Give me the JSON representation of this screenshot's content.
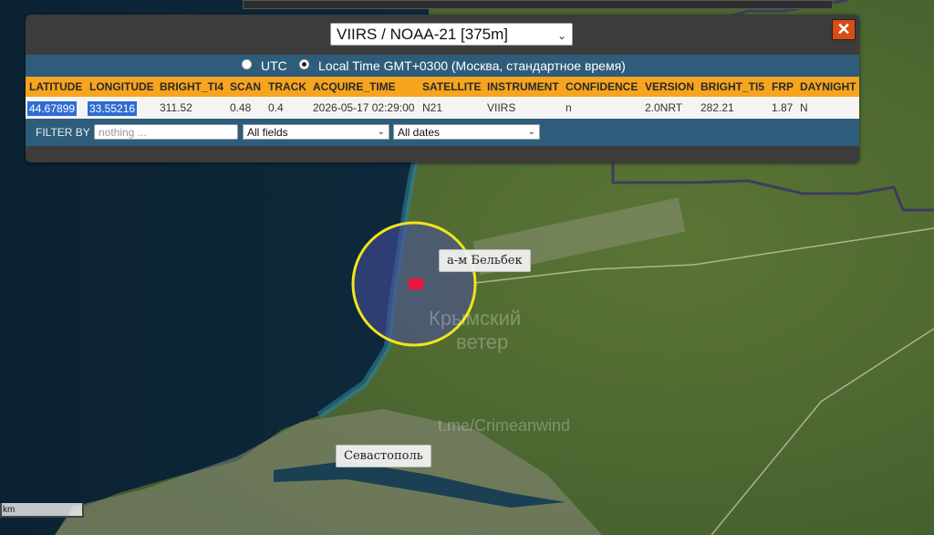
{
  "panel": {
    "satellite_select": "VIIRS / NOAA-21 [375m]",
    "close_label": "✕",
    "time_mode": {
      "utc_label": "UTC",
      "local_label": "Local Time GMT+0300 (Москва, стандартное время)",
      "selected": "local"
    },
    "columns": [
      "LATITUDE",
      "LONGITUDE",
      "BRIGHT_TI4",
      "SCAN",
      "TRACK",
      "ACQUIRE_TIME",
      "SATELLITE",
      "INSTRUMENT",
      "CONFIDENCE",
      "VERSION",
      "BRIGHT_TI5",
      "FRP",
      "DAYNIGHT"
    ],
    "row": [
      "44.67899",
      "33.55216",
      "311.52",
      "0.48",
      "0.4",
      "2026-05-17 02:29:00",
      "N21",
      "VIIRS",
      "n",
      "2.0NRT",
      "282.21",
      "1.87",
      "N"
    ],
    "filter": {
      "label": "FILTER BY",
      "placeholder": "nothing ...",
      "field_select": "All fields",
      "date_select": "All dates"
    }
  },
  "map": {
    "labels": {
      "airbase": "а-м Бельбек",
      "city": "Севастополь"
    },
    "watermark": [
      "Крымский",
      "ветер",
      "t.me/Crimeanwind"
    ],
    "scale_unit": "km",
    "colors": {
      "sea": "#0e2a3d",
      "land": "#4f6a32",
      "highlight_circle": "#f2e41b",
      "fire_marker": "#e8183a",
      "border_line": "#3d3d5c"
    }
  }
}
